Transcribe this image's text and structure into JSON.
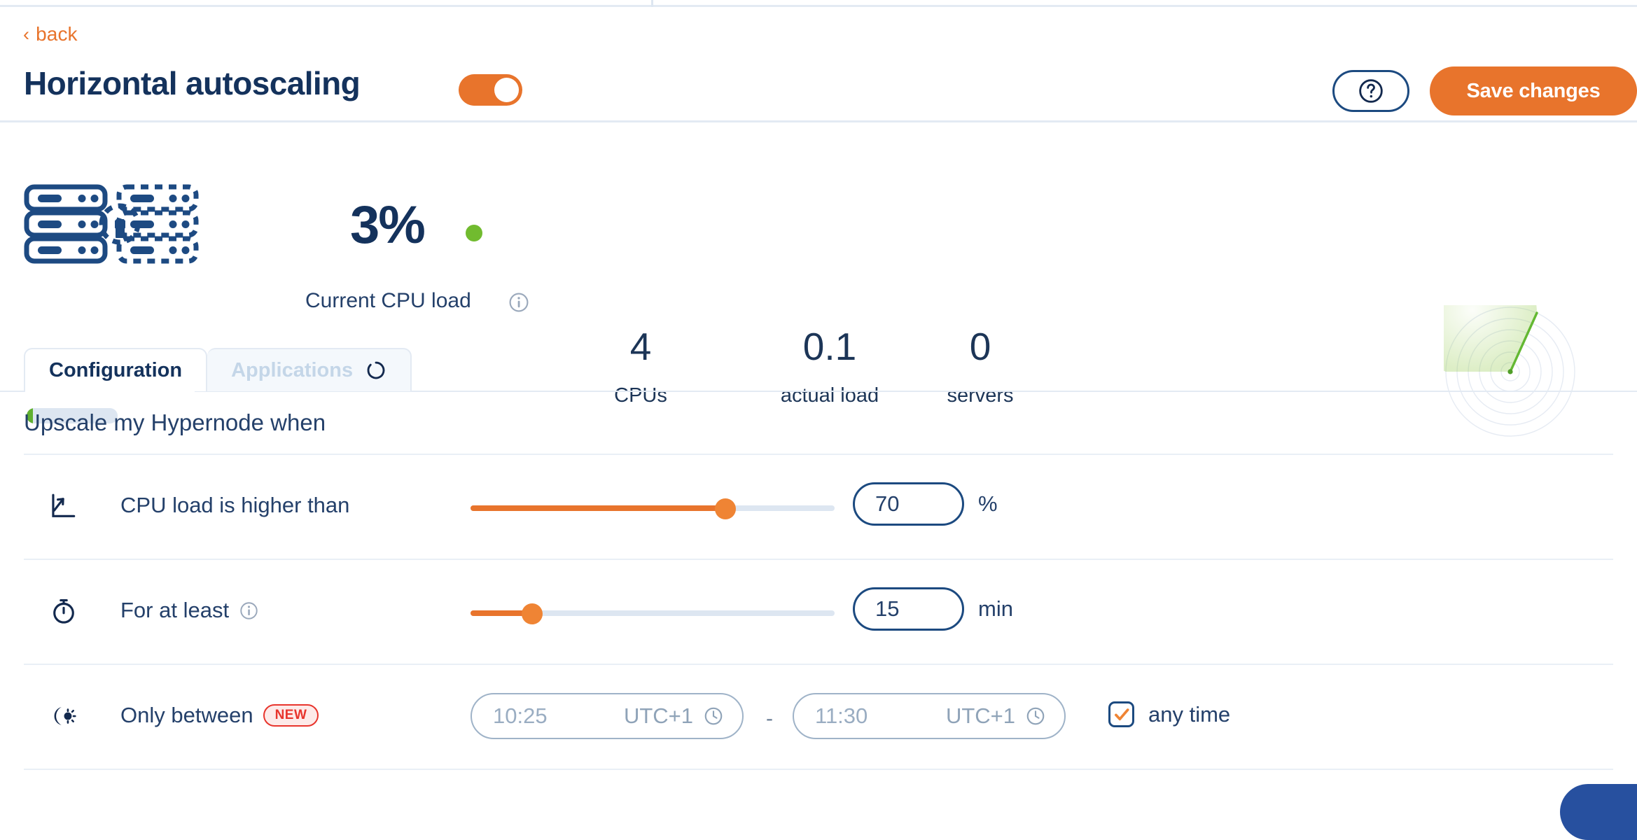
{
  "header": {
    "back_label": "back",
    "back_chevron": "chevron-left-icon",
    "title": "Horizontal autoscaling",
    "toggle_state": "on",
    "help_icon": "question-circle-icon",
    "save_label": "Save changes"
  },
  "stats": {
    "server_icon": "server-stack-add-icon",
    "cpu_value": "3%",
    "cpu_status_color": "#71bb2f",
    "cpu_label": "Current CPU load",
    "cpu_info_icon": "info-circle-icon",
    "progress_percent": 7,
    "radar_icon": "radar-sweep-graphic",
    "metrics": [
      {
        "value": "4",
        "label": "CPUs"
      },
      {
        "value": "0.1",
        "label": "actual load"
      },
      {
        "value": "0",
        "label": "servers"
      }
    ]
  },
  "tabs": [
    {
      "label": "Configuration",
      "active": true,
      "spinner": false
    },
    {
      "label": "Applications",
      "active": false,
      "spinner": true
    }
  ],
  "section": {
    "title": "Upscale my Hypernode when"
  },
  "rows": {
    "cpu_load": {
      "icon": "chart-line-icon",
      "label": "CPU load is higher than",
      "slider_percent": 70,
      "value": "70",
      "unit": "%"
    },
    "for_at_least": {
      "icon": "stopwatch-icon",
      "label": "For at least",
      "info_icon": "info-circle-icon",
      "slider_percent": 17,
      "value": "15",
      "unit": "min"
    },
    "only_between": {
      "icon": "day-night-icon",
      "label": "Only between",
      "badge": "NEW",
      "start_time": "10:25",
      "start_tz": "UTC+1",
      "end_time": "11:30",
      "end_tz": "UTC+1",
      "separator": "-",
      "clock_icon": "clock-icon",
      "any_time_label": "any time",
      "any_time_checked": true,
      "check_icon": "check-icon"
    }
  },
  "colors": {
    "accent_orange": "#e8742c",
    "navy": "#14325c",
    "green": "#71bb2f",
    "red": "#e8352d",
    "border_light": "#e3eaf3"
  }
}
